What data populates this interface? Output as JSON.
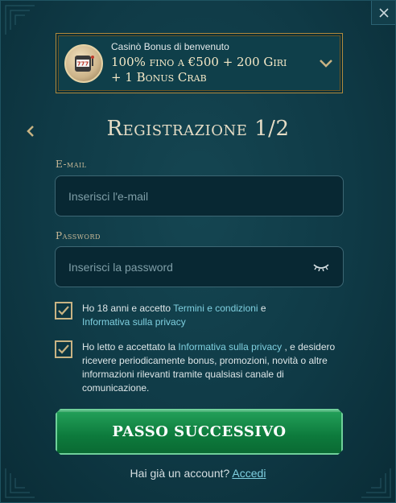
{
  "bonus": {
    "subtitle": "Casinò Bonus di benvenuto",
    "headline_line1": "100% fino a €500 + 200 Giri",
    "headline_line2": "+ 1 Bonus Crab",
    "logo_icon": "slot-machine-icon",
    "toggle_icon": "chevron-down-icon"
  },
  "header": {
    "title": "Registrazione 1/2",
    "back_icon": "chevron-left-icon",
    "close_icon": "close-icon"
  },
  "form": {
    "email": {
      "label": "E-mail",
      "placeholder": "Inserisci l'e-mail",
      "value": ""
    },
    "password": {
      "label": "Password",
      "placeholder": "Inserisci la password",
      "value": "",
      "toggle_icon": "eye-closed-icon"
    },
    "consent_age": {
      "checked": true,
      "text_before": "Ho 18 anni e accetto ",
      "link_terms": "Termini e condizioni",
      "text_middle": " e ",
      "link_privacy": "Informativa sulla privacy"
    },
    "consent_marketing": {
      "checked": true,
      "text_before": "Ho letto e accettato la ",
      "link_privacy": "Informativa sulla privacy",
      "text_after": " , e desidero ricevere periodicamente bonus, promozioni, novità o altre informazioni rilevanti tramite qualsiasi canale di comunicazione."
    },
    "submit_label": "PASSO SUCCESSIVO"
  },
  "footer": {
    "question": "Hai già un account? ",
    "login_link": "Accedi"
  },
  "colors": {
    "background": "#0f3a46",
    "accent_gold": "#c8b383",
    "link": "#7fd0e0",
    "button_green": "#0d7a3c"
  }
}
